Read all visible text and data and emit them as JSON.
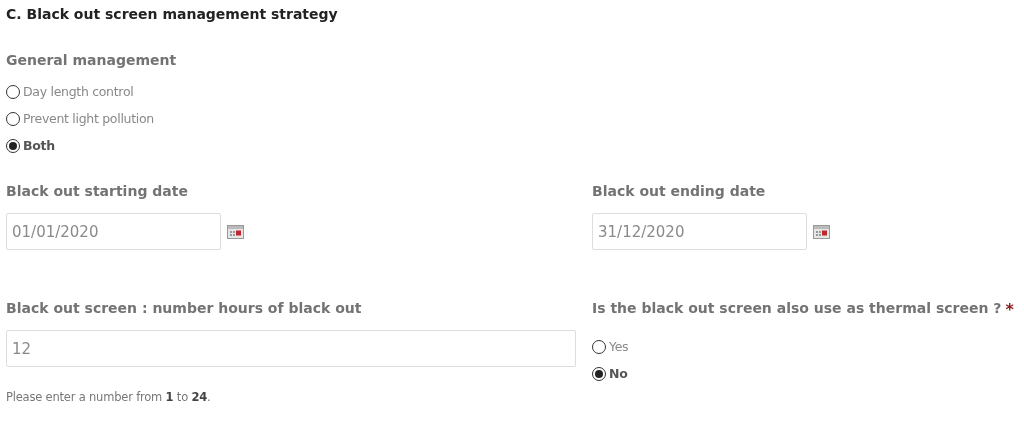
{
  "section_title": "C. Black out screen management strategy",
  "general_management": {
    "label": "General management",
    "options": [
      {
        "label": "Day length control",
        "selected": false
      },
      {
        "label": "Prevent light pollution",
        "selected": false
      },
      {
        "label": "Both",
        "selected": true
      }
    ]
  },
  "start_date": {
    "label": "Black out starting date",
    "value": "01/01/2020"
  },
  "end_date": {
    "label": "Black out ending date",
    "value": "31/12/2020"
  },
  "hours": {
    "label": "Black out screen : number hours of black out",
    "value": "12",
    "help": "Please enter a number from **1** to **24**."
  },
  "thermal": {
    "label": "Is the black out screen also use as thermal screen ?",
    "required_mark": "*",
    "options": [
      {
        "label": "Yes",
        "selected": false
      },
      {
        "label": "No",
        "selected": true
      }
    ]
  }
}
